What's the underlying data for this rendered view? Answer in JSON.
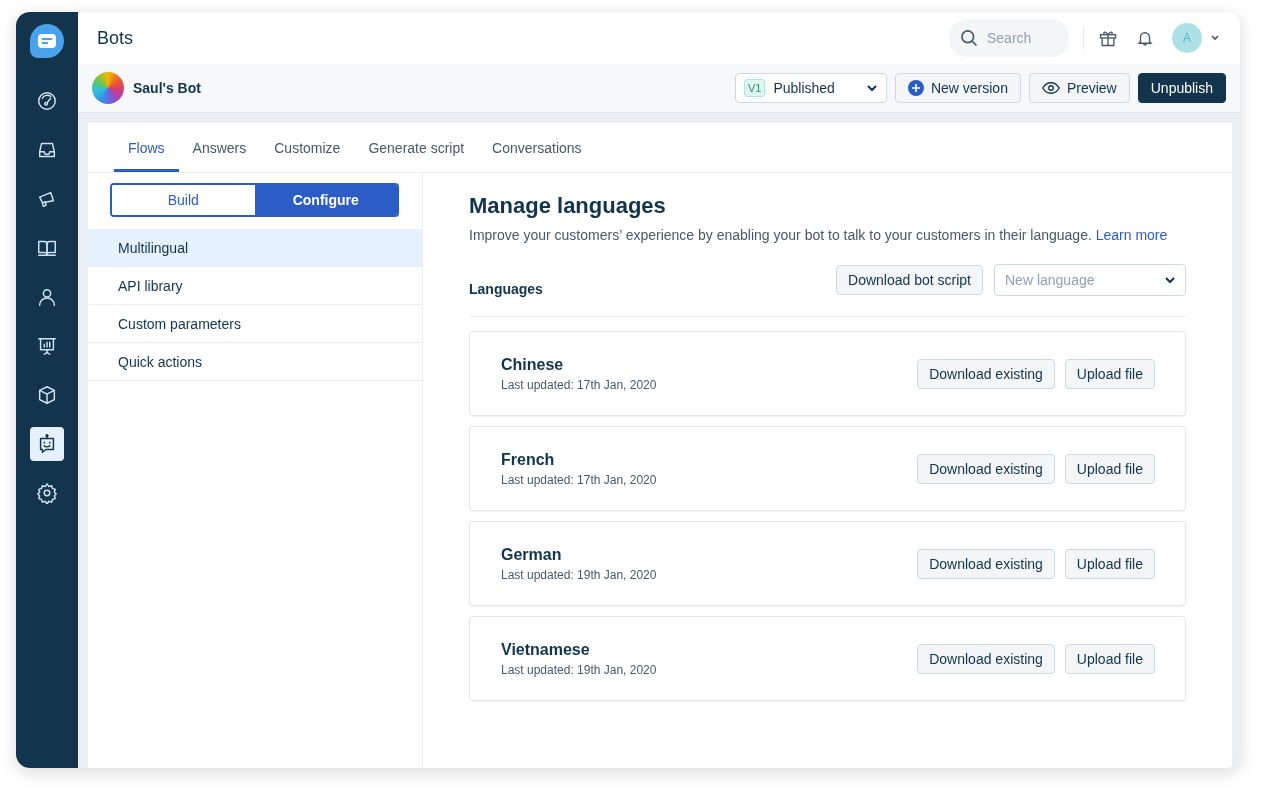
{
  "header": {
    "title": "Bots",
    "search": {
      "placeholder": "Search"
    },
    "avatar": "A"
  },
  "sidebar": {
    "items": [
      {
        "kind": "gauge",
        "selected": false
      },
      {
        "kind": "inbox",
        "selected": false
      },
      {
        "kind": "megaphone",
        "selected": false
      },
      {
        "kind": "book",
        "selected": false
      },
      {
        "kind": "person",
        "selected": false
      },
      {
        "kind": "chart",
        "selected": false
      },
      {
        "kind": "box",
        "selected": false
      },
      {
        "kind": "bot",
        "selected": true
      },
      {
        "kind": "gear",
        "selected": false
      }
    ]
  },
  "bot": {
    "name": "Saul's Bot",
    "version_badge": "V1",
    "version_status": "Published",
    "buttons": [
      {
        "label": "New version",
        "kind": "add"
      },
      {
        "label": "Preview",
        "kind": "preview"
      },
      {
        "label": "Unpublish",
        "kind": "primary"
      }
    ]
  },
  "tabs": [
    {
      "label": "Flows",
      "selected": true
    },
    {
      "label": "Answers",
      "selected": false
    },
    {
      "label": "Customize",
      "selected": false
    },
    {
      "label": "Generate script",
      "selected": false
    },
    {
      "label": "Conversations",
      "selected": false
    }
  ],
  "mode_toggle": [
    {
      "label": "Build",
      "selected": false
    },
    {
      "label": "Configure",
      "selected": true
    }
  ],
  "settings_menu": [
    {
      "label": "Multilingual",
      "selected": true
    },
    {
      "label": "API library",
      "selected": false
    },
    {
      "label": "Custom parameters",
      "selected": false
    },
    {
      "label": "Quick actions",
      "selected": false
    }
  ],
  "content": {
    "title": "Manage languages",
    "description": "Improve your customers’ experience by enabling your bot to talk to your customers in their language.",
    "link": "Learn more",
    "section_label": "Languages",
    "download_button": "Download bot script",
    "new_language": {
      "placeholder": "New language"
    },
    "languages": [
      {
        "name": "Chinese",
        "updated": "Last updated: 17th Jan, 2020",
        "download": "Download existing",
        "upload": "Upload file"
      },
      {
        "name": "French",
        "updated": "Last updated: 17th Jan, 2020",
        "download": "Download existing",
        "upload": "Upload file"
      },
      {
        "name": "German",
        "updated": "Last updated: 19th Jan, 2020",
        "download": "Download existing",
        "upload": "Upload file"
      },
      {
        "name": "Vietnamese",
        "updated": "Last updated: 19th Jan, 2020",
        "download": "Download existing",
        "upload": "Upload file"
      }
    ]
  }
}
